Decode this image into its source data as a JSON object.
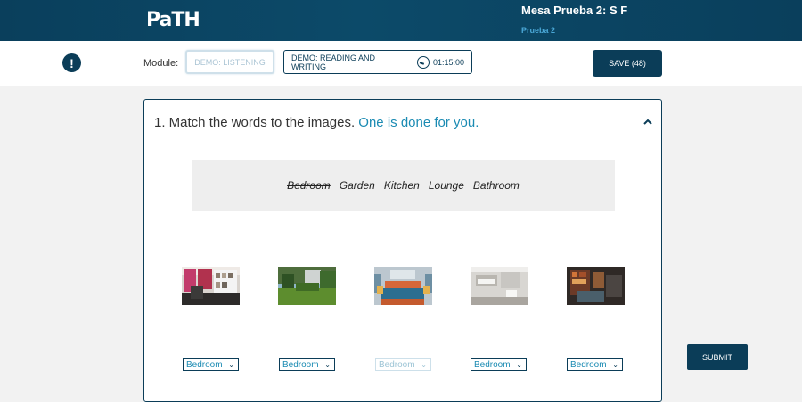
{
  "header": {
    "logo": "PaTH",
    "candidate": "Mesa Prueba 2:   S F",
    "subtitle": "Prueba 2"
  },
  "toolbar": {
    "alert_icon": "exclamation-icon",
    "module_label": "Module:",
    "modules": [
      {
        "label": "DEMO: LISTENING",
        "state": "disabled"
      },
      {
        "label": "DEMO: READING AND WRITING",
        "timer": "01:15:00",
        "state": "active"
      }
    ],
    "save_label": "SAVE  (48)"
  },
  "question": {
    "title": "1. Match the words to the images.",
    "hint": "One is done for you.",
    "words": [
      {
        "text": "Bedroom",
        "used": true
      },
      {
        "text": "Garden",
        "used": false
      },
      {
        "text": "Kitchen",
        "used": false
      },
      {
        "text": "Lounge",
        "used": false
      },
      {
        "text": "Bathroom",
        "used": false
      }
    ],
    "images": [
      {
        "name": "kitchen-photo",
        "selected": "Bedroom",
        "disabled": false
      },
      {
        "name": "garden-photo",
        "selected": "Bedroom",
        "disabled": false
      },
      {
        "name": "bedroom-photo",
        "selected": "Bedroom",
        "disabled": true
      },
      {
        "name": "bathroom-photo",
        "selected": "Bedroom",
        "disabled": false
      },
      {
        "name": "lounge-photo",
        "selected": "Bedroom",
        "disabled": false
      }
    ]
  },
  "submit_label": "SUBMIT",
  "colors": {
    "primary": "#0b3d58",
    "accent": "#1b8bb3"
  }
}
